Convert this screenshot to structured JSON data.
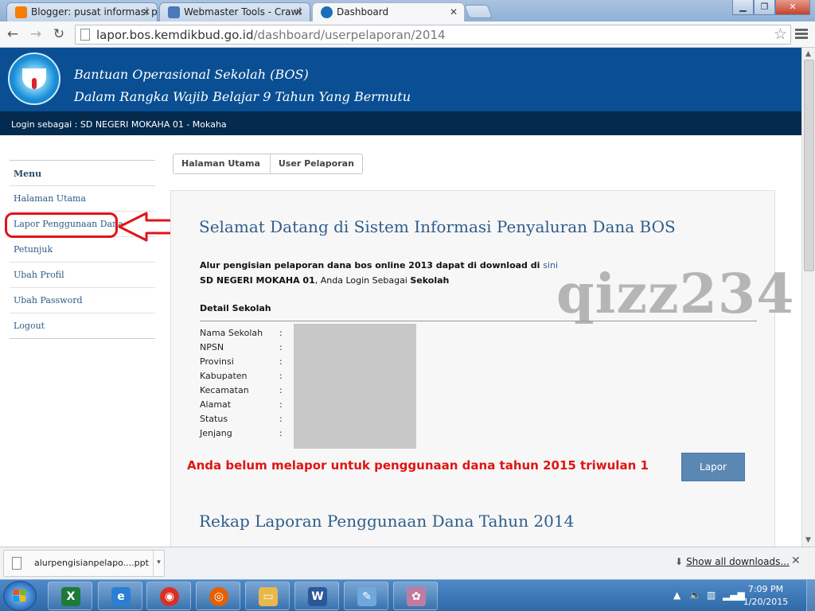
{
  "browser": {
    "tabs": [
      {
        "title": "Blogger: pusat informasi p",
        "icon": "blogger-icon",
        "color": "#f57d00"
      },
      {
        "title": "Webmaster Tools - Crawl",
        "icon": "webmaster-tools-icon",
        "color": "#4a78b8"
      },
      {
        "title": "Dashboard",
        "icon": "kemdikbud-logo-icon",
        "color": "#1b6fb8"
      }
    ],
    "tab_close": "✕",
    "window_buttons": {
      "minimize": "▁",
      "maximize": "❐",
      "close": "✕"
    },
    "url_host": "lapor.bos.kemdikbud.go.id",
    "url_path": "/dashboard/userpelaporan/2014"
  },
  "site": {
    "title_line1": "Bantuan Operasional Sekolah (BOS)",
    "title_line2": "Dalam Rangka Wajib Belajar 9 Tahun Yang Bermutu",
    "login_text": "Login sebagai : SD NEGERI MOKAHA 01 - Mokaha",
    "brand_color": "#0a4f93"
  },
  "sidebar": {
    "header": "Menu",
    "items": [
      {
        "label": "Halaman Utama"
      },
      {
        "label": "Lapor Penggunaan Dana"
      },
      {
        "label": "Petunjuk"
      },
      {
        "label": "Ubah Profil"
      },
      {
        "label": "Ubah Password"
      },
      {
        "label": "Logout"
      }
    ]
  },
  "breadcrumb": {
    "home": "Halaman Utama",
    "current": "User Pelaporan"
  },
  "main": {
    "welcome": "Selamat Datang di Sistem Informasi Penyaluran Dana BOS",
    "intro_text": "Alur pengisian pelaporan dana bos online 2013 dapat di download di",
    "intro_link": "sini",
    "school_name": "SD NEGERI MOKAHA 01",
    "login_as_text": ", Anda Login Sebagai",
    "role": "Sekolah",
    "detail_title": "Detail Sekolah",
    "detail_fields": [
      {
        "label": "Nama Sekolah",
        "sep": ":"
      },
      {
        "label": "NPSN",
        "sep": ":"
      },
      {
        "label": "Provinsi",
        "sep": ":"
      },
      {
        "label": "Kabupaten",
        "sep": ":"
      },
      {
        "label": "Kecamatan",
        "sep": ":"
      },
      {
        "label": "Alamat",
        "sep": ":"
      },
      {
        "label": "Status",
        "sep": ":"
      },
      {
        "label": "Jenjang",
        "sep": ":"
      }
    ],
    "watermark": "qizz234",
    "warning": "Anda belum melapor untuk penggunaan dana tahun 2015 triwulan 1",
    "lapor_button": "Lapor",
    "rekap_title": "Rekap Laporan Penggunaan Dana Tahun 2014",
    "warning_color": "#e01414"
  },
  "downloads": {
    "file_name": "alurpengisianpelapo....ppt",
    "show_all": "Show all downloads...",
    "close": "✕"
  },
  "taskbar": {
    "apps": [
      {
        "name": "excel",
        "glyph": "X",
        "color": "#1f7a3a"
      },
      {
        "name": "internet-explorer",
        "glyph": "e",
        "color": "#2a7fd4"
      },
      {
        "name": "chrome",
        "glyph": "◉",
        "color": "#d93025"
      },
      {
        "name": "firefox",
        "glyph": "◎",
        "color": "#e66000"
      },
      {
        "name": "file-explorer",
        "glyph": "▭",
        "color": "#e8b84a"
      },
      {
        "name": "word",
        "glyph": "W",
        "color": "#2b579a"
      },
      {
        "name": "notepad",
        "glyph": "✎",
        "color": "#6fa8dc"
      },
      {
        "name": "paint",
        "glyph": "✿",
        "color": "#c27ba0"
      }
    ],
    "time": "7:09 PM",
    "date": "1/20/2015"
  }
}
